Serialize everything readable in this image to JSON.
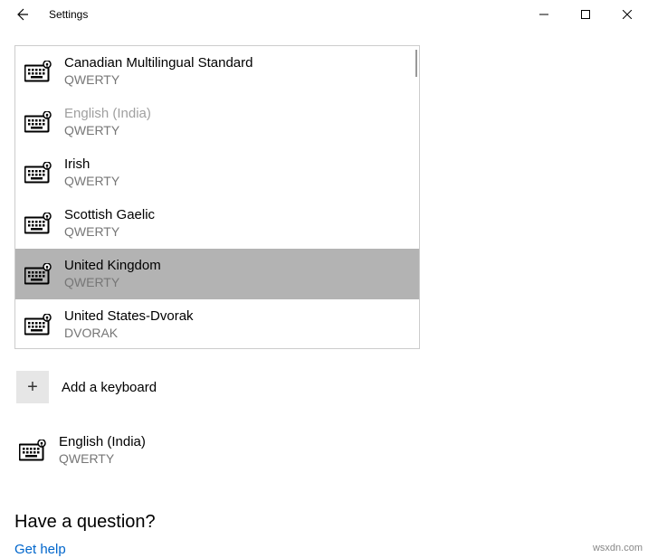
{
  "titlebar": {
    "title": "Settings"
  },
  "keyboards": [
    {
      "name": "Canadian Multilingual Standard",
      "sub": "QWERTY",
      "state": "normal"
    },
    {
      "name": "English (India)",
      "sub": "QWERTY",
      "state": "disabled"
    },
    {
      "name": "Irish",
      "sub": "QWERTY",
      "state": "normal"
    },
    {
      "name": "Scottish Gaelic",
      "sub": "QWERTY",
      "state": "normal"
    },
    {
      "name": "United Kingdom",
      "sub": "QWERTY",
      "state": "selected"
    },
    {
      "name": "United States-Dvorak",
      "sub": "DVORAK",
      "state": "normal"
    }
  ],
  "add": {
    "label": "Add a keyboard"
  },
  "current": {
    "name": "English (India)",
    "sub": "QWERTY"
  },
  "footer": {
    "question": "Have a question?",
    "link": "Get help"
  },
  "watermark": "wsxdn.com"
}
